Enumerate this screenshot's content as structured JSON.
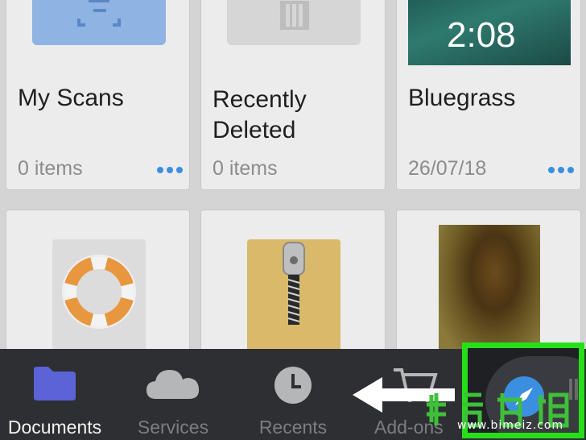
{
  "cards": [
    {
      "id": "my-scans",
      "title": "My Scans",
      "meta": "0 items",
      "has_more": true
    },
    {
      "id": "recently-deleted",
      "title": "Recently\nDeleted",
      "meta": "0 items",
      "has_more": false
    },
    {
      "id": "bluegrass",
      "title": "Bluegrass",
      "meta": "26/07/18",
      "has_more": true,
      "thumb_text": "2:08"
    }
  ],
  "tabs": [
    {
      "label": "Documents",
      "icon": "folder-icon",
      "active": true
    },
    {
      "label": "Services",
      "icon": "cloud-icon",
      "active": false
    },
    {
      "label": "Recents",
      "icon": "clock-icon",
      "active": false
    },
    {
      "label": "Add-ons",
      "icon": "cart-icon",
      "active": false
    }
  ],
  "watermark": {
    "url": "www.bimeiz.com"
  },
  "colors": {
    "accent": "#3c8fe0",
    "highlight": "#25e019",
    "tabbar": "#2e2f33"
  }
}
